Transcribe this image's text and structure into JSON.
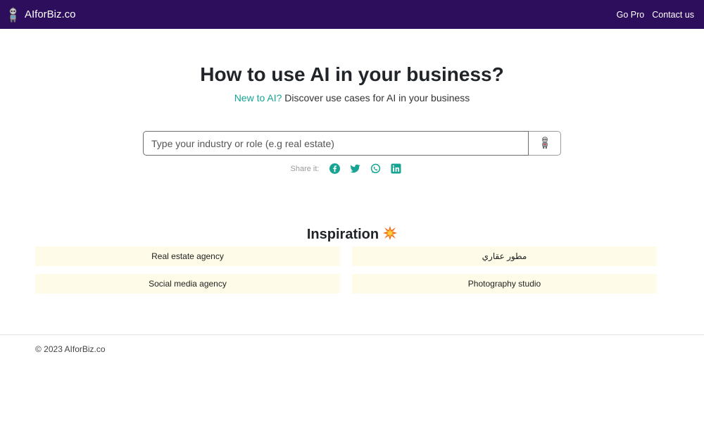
{
  "navbar": {
    "brand": "AIforBiz.co",
    "links": [
      "Go Pro",
      "Contact us"
    ],
    "background": "#2d0e5c"
  },
  "hero": {
    "title": "How to use AI in your business?",
    "subtitle_accent": "New to AI?",
    "subtitle_rest": " Discover use cases for AI in your business",
    "accent_color": "#17a493"
  },
  "search": {
    "placeholder": "Type your industry or role (e.g real estate)",
    "value": "",
    "button_icon": "robot-icon"
  },
  "share": {
    "label": "Share it:",
    "icons": [
      "facebook-icon",
      "twitter-icon",
      "whatsapp-icon",
      "linkedin-icon"
    ]
  },
  "inspiration": {
    "title": "Inspiration",
    "emoji": "collision-emoji",
    "items": [
      "Real estate agency",
      "مطور عقاري",
      "Social media agency",
      "Photography studio"
    ],
    "card_color": "#fefce8"
  },
  "footer": {
    "copyright": "© 2023 AIforBiz.co"
  }
}
